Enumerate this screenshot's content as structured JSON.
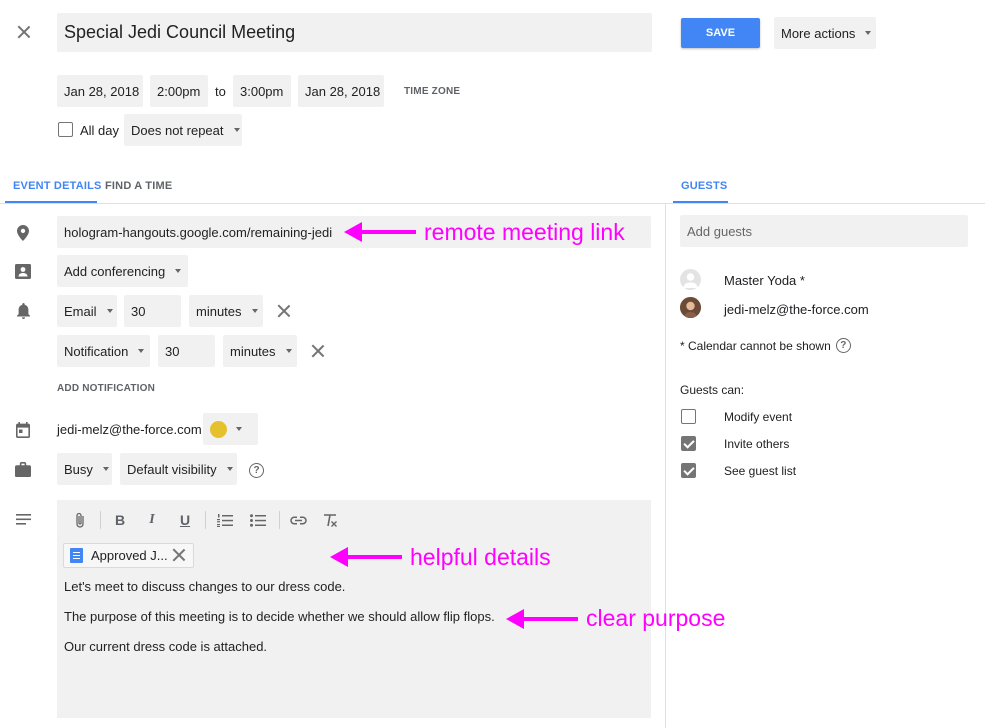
{
  "header": {
    "title": "Special Jedi Council Meeting",
    "save_label": "SAVE",
    "more_actions_label": "More actions"
  },
  "datetime": {
    "start_date": "Jan 28, 2018",
    "start_time": "2:00pm",
    "to_label": "to",
    "end_time": "3:00pm",
    "end_date": "Jan 28, 2018",
    "time_zone_label": "TIME ZONE",
    "all_day_label": "All day",
    "repeat_value": "Does not repeat"
  },
  "tabs": {
    "event_details": "EVENT DETAILS",
    "find_a_time": "FIND A TIME",
    "guests": "GUESTS"
  },
  "details": {
    "location_value": "hologram-hangouts.google.com/remaining-jedi",
    "conferencing_label": "Add conferencing",
    "notifications": [
      {
        "type": "Email",
        "amount": "30",
        "unit": "minutes"
      },
      {
        "type": "Notification",
        "amount": "30",
        "unit": "minutes"
      }
    ],
    "add_notification_label": "ADD NOTIFICATION",
    "calendar_owner": "jedi-melz@the-force.com",
    "event_color": "#e6c12e",
    "busy_value": "Busy",
    "visibility_value": "Default visibility"
  },
  "description": {
    "attachment_label": "Approved J...",
    "lines": [
      "Let's meet to discuss changes to our dress code.",
      "The purpose of this meeting is to decide whether we should allow flip flops.",
      "Our current dress code is attached."
    ]
  },
  "annotations": {
    "link_note": "remote meeting link",
    "details_note": "helpful details",
    "purpose_note": "clear purpose",
    "color": "#ff00ff"
  },
  "guests": {
    "add_placeholder": "Add guests",
    "list": [
      {
        "name": "Master Yoda *"
      },
      {
        "name": "jedi-melz@the-force.com"
      }
    ],
    "calendar_note": "* Calendar cannot be shown",
    "permissions_label": "Guests can:",
    "permissions": [
      {
        "label": "Modify event",
        "checked": false
      },
      {
        "label": "Invite others",
        "checked": true
      },
      {
        "label": "See guest list",
        "checked": true
      }
    ]
  },
  "colors": {
    "accent": "#4285f4",
    "field_bg": "#f1f1f1"
  }
}
